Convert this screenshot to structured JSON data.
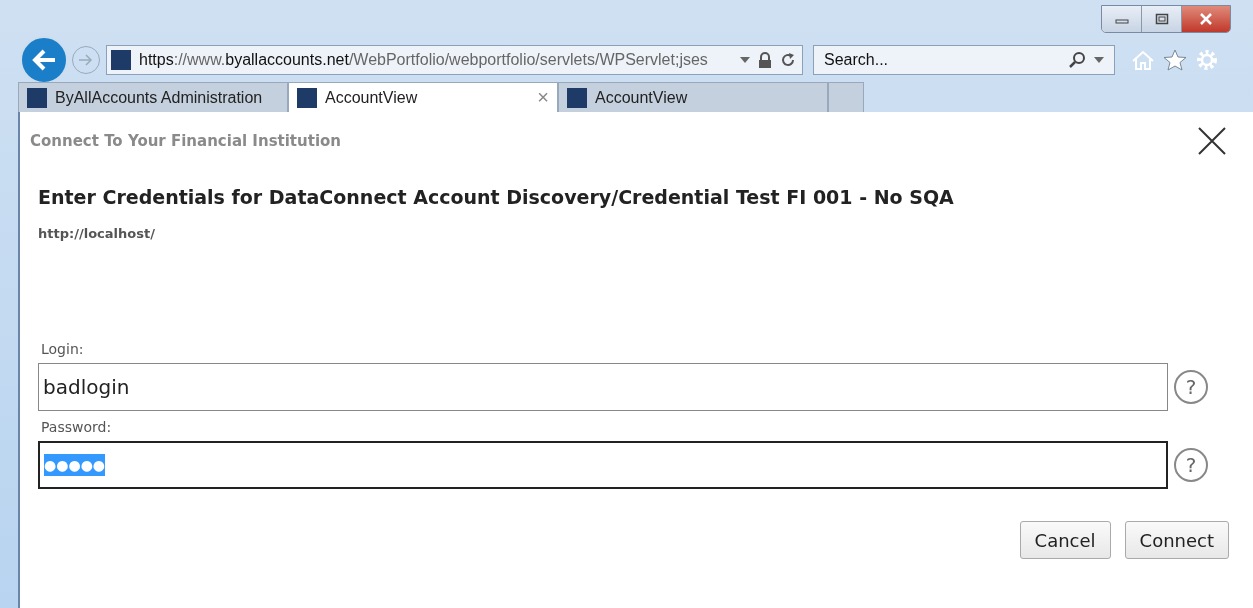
{
  "browser": {
    "address": [
      {
        "text": "https",
        "emphasis": true
      },
      {
        "text": "://www.",
        "emphasis": false
      },
      {
        "text": "byallaccounts.net",
        "emphasis": true
      },
      {
        "text": "/WebPortfolio/webportfolio/servlets/WPServlet;jses",
        "emphasis": false
      }
    ],
    "search": {
      "placeholder": "Search..."
    }
  },
  "tabs": [
    {
      "label": "ByAllAccounts Administration",
      "selected": false
    },
    {
      "label": "AccountView",
      "selected": true,
      "close": "×"
    },
    {
      "label": "AccountView",
      "selected": false
    }
  ],
  "dialog": {
    "title": "Connect To Your Financial Institution",
    "heading": "Enter Credentials for DataConnect Account Discovery/Credential Test FI 001 - No SQA",
    "url": "http://localhost/",
    "fields": [
      {
        "label": "Login:",
        "value": "badlogin",
        "focused": false,
        "text_selected": false,
        "help": "?"
      },
      {
        "label": "Password:",
        "value": "●●●●●",
        "focused": true,
        "text_selected": true,
        "help": "?"
      }
    ],
    "buttons": [
      "Cancel",
      "Connect"
    ]
  }
}
